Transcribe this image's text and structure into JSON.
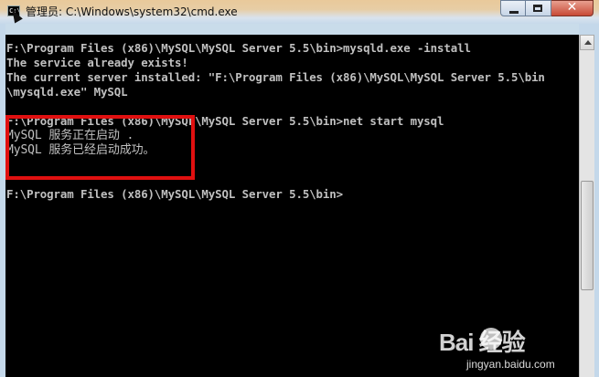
{
  "window": {
    "title": "管理员: C:\\Windows\\system32\\cmd.exe",
    "icon_text": "C:\\",
    "controls": {
      "minimize": "minimize-icon",
      "maximize": "maximize-icon",
      "close": "✕"
    }
  },
  "console": {
    "lines": [
      "",
      "F:\\Program Files (x86)\\MySQL\\MySQL Server 5.5\\bin>mysqld.exe -install",
      "The service already exists!",
      "The current server installed: \"F:\\Program Files (x86)\\MySQL\\MySQL Server 5.5\\bin",
      "\\mysqld.exe\" MySQL",
      "",
      "F:\\Program Files (x86)\\MySQL\\MySQL Server 5.5\\bin>net start mysql",
      "MySQL 服务正在启动 .",
      "MySQL 服务已经启动成功。",
      "",
      "",
      "F:\\Program Files (x86)\\MySQL\\MySQL Server 5.5\\bin>"
    ],
    "text_color": "#c0c0c0",
    "background": "#000000"
  },
  "annotation": {
    "box_color": "#e01010"
  },
  "watermark": {
    "logo": "Bai  经验",
    "site": "jingyan.baidu.com"
  }
}
